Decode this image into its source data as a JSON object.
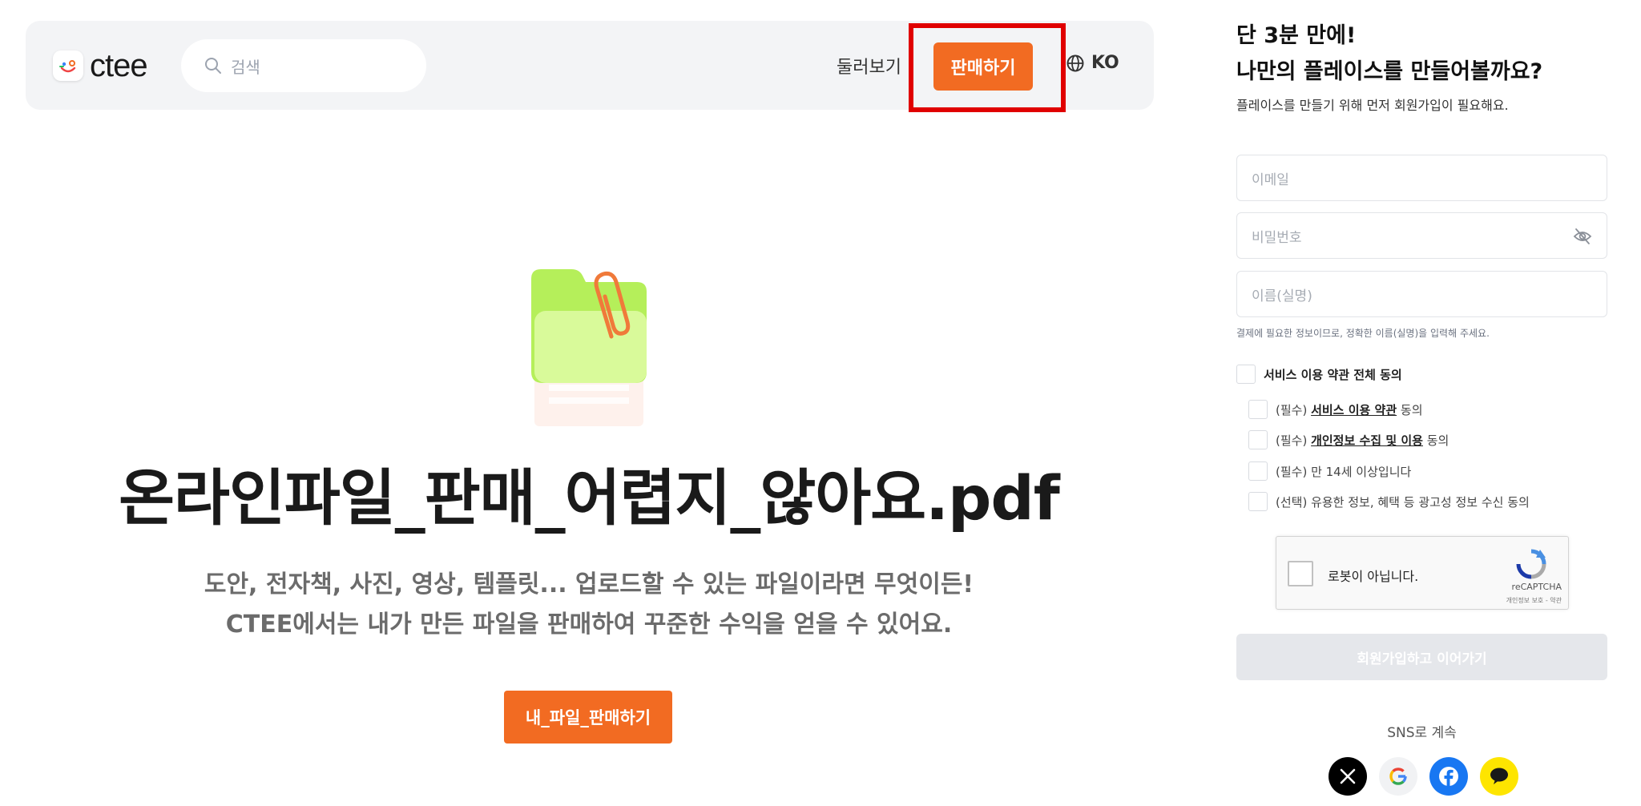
{
  "header": {
    "logo_text": "ctee",
    "search_placeholder": "검색",
    "nav_browse": "둘러보기",
    "nav_sell": "판매하기",
    "language": "KO"
  },
  "hero": {
    "title": "온라인파일_판매_어렵지_않아요.pdf",
    "subtitle_line1": "도안, 전자책, 사진, 영상, 템플릿... 업로드할 수 있는 파일이라면 무엇이든!",
    "subtitle_line2": "CTEE에서는 내가 만든 파일을 판매하여 꾸준한 수익을 얻을 수 있어요.",
    "cta": "내_파일_판매하기"
  },
  "signup": {
    "title_line1": "단 3분 만에!",
    "title_line2": "나만의 플레이스를 만들어볼까요?",
    "description": "플레이스를 만들기 위해 먼저 회원가입이 필요해요.",
    "email_placeholder": "이메일",
    "password_placeholder": "비밀번호",
    "name_placeholder": "이름(실명)",
    "name_hint": "결제에 필요한 정보이므로, 정확한 이름(실명)을 입력해 주세요.",
    "agree_all": "서비스 이용 약관 전체 동의",
    "terms": [
      {
        "prefix": "(필수) ",
        "link": "서비스 이용 약관",
        "suffix": " 동의"
      },
      {
        "prefix": "(필수) ",
        "link": "개인정보 수집 및 이용",
        "suffix": " 동의"
      },
      {
        "prefix": "(필수) 만 14세 이상입니다",
        "link": "",
        "suffix": ""
      },
      {
        "prefix": "(선택) 유용한 정보, 혜택 등 광고성 정보 수신 동의",
        "link": "",
        "suffix": ""
      }
    ],
    "captcha_label": "로봇이 아닙니다.",
    "captcha_brand": "reCAPTCHA",
    "captcha_terms": "개인정보 보호 - 약관",
    "submit": "회원가입하고 이어가기",
    "sns_label": "SNS로 계속"
  },
  "colors": {
    "accent": "#f26b22",
    "highlight": "#e00000",
    "facebook": "#1877f2",
    "kakao": "#fee500"
  },
  "icons": [
    "search-icon",
    "globe-icon",
    "eye-off-icon",
    "recaptcha-icon",
    "x-icon",
    "google-icon",
    "facebook-icon",
    "kakao-icon"
  ]
}
